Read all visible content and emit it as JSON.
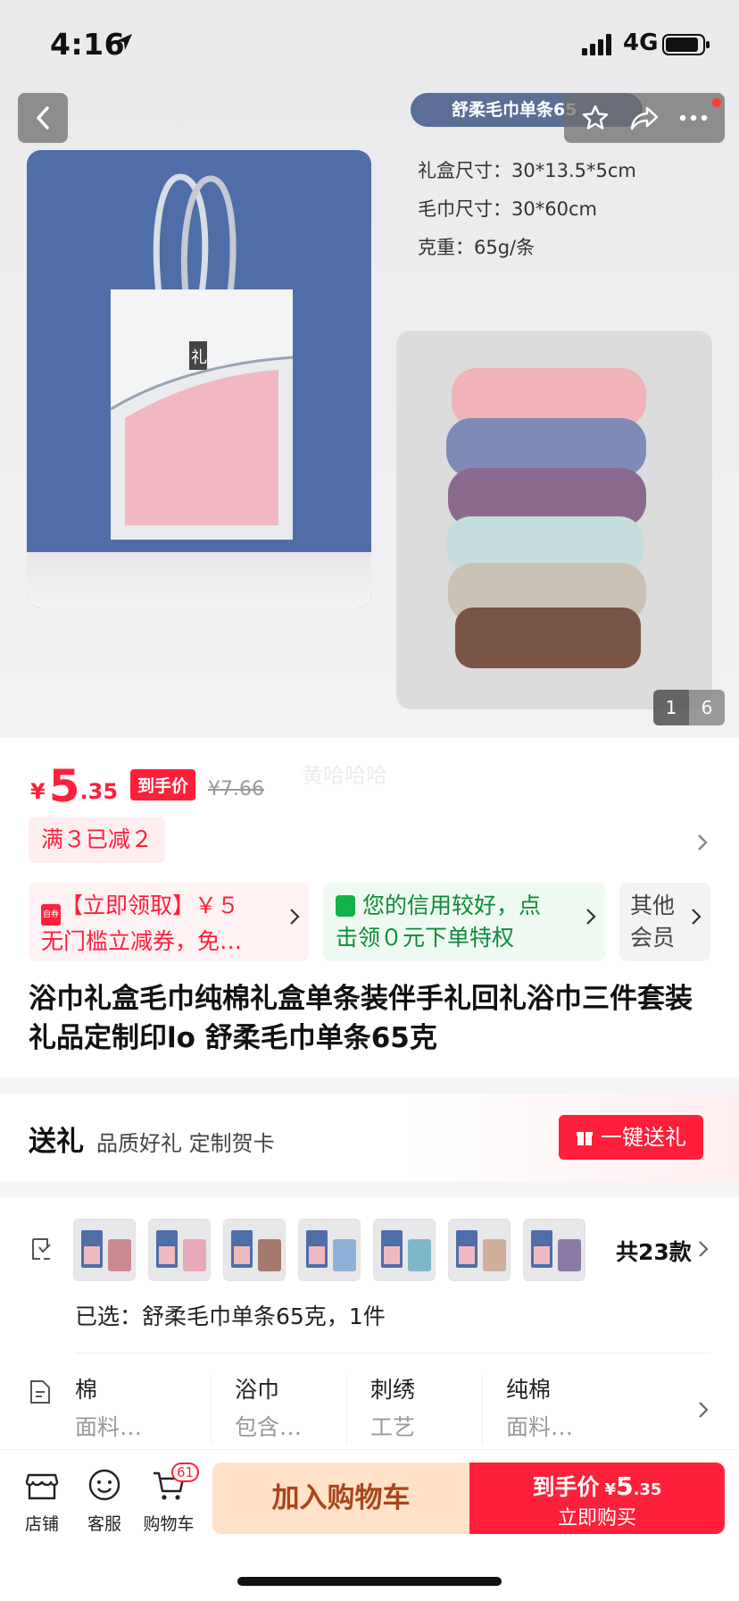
{
  "status_bar": {
    "time": "4:16",
    "network": "4G"
  },
  "hero": {
    "pill_label": "舒柔毛巾单条65",
    "specs": [
      "礼盒尺寸：30*13.5*5cm",
      "毛巾尺寸：30*60cm",
      "克重：65g/条"
    ],
    "box_logo": "礼",
    "image_index": "1",
    "image_total": "6"
  },
  "price": {
    "currency": "¥",
    "integer": "5",
    "decimal": ".35",
    "tag": "到手价",
    "original": "¥7.66",
    "watermark": "黄哈哈哈"
  },
  "promo": {
    "label": "满３已减２"
  },
  "cards": {
    "coupon_badge": "自券",
    "coupon_line1": "【立即领取】￥５",
    "coupon_line2": "无门槛立减券，免…",
    "credit_line1": "您的信用较好，点",
    "credit_line2": "击领０元下单特权",
    "other_line1": "其他",
    "other_line2": "会员"
  },
  "product_title": "浴巾礼盒毛巾纯棉礼盒单条装伴手礼回礼浴巾三件套装礼品定制印lo 舒柔毛巾单条65克",
  "gift": {
    "heading": "送礼",
    "subtitle": "品质好礼 定制贺卡",
    "button": "一键送礼"
  },
  "sku": {
    "count_label": "共23款",
    "thumb_colors": [
      "#c98a8f",
      "#e7a9b6",
      "#a5796b",
      "#8fb0d6",
      "#7fb8c9",
      "#cfae9c",
      "#8a7aa6"
    ],
    "selected": "已选：舒柔毛巾单条65克，1件"
  },
  "attributes": [
    {
      "key": "棉",
      "value": "面料…"
    },
    {
      "key": "浴巾",
      "value": "包含…"
    },
    {
      "key": "刺绣",
      "value": "工艺"
    },
    {
      "key": "纯棉",
      "value": "面料…"
    }
  ],
  "bottom_bar": {
    "shop": "店铺",
    "service": "客服",
    "cart": "购物车",
    "cart_count": "61",
    "add_to_cart": "加入购物车",
    "buy_label": "到手价",
    "buy_currency": "¥",
    "buy_int": "5",
    "buy_dec": ".35",
    "buy_now": "立即购买"
  },
  "colors": {
    "accent": "#ff1f3a",
    "brand_blue": "#4f6ea8"
  }
}
